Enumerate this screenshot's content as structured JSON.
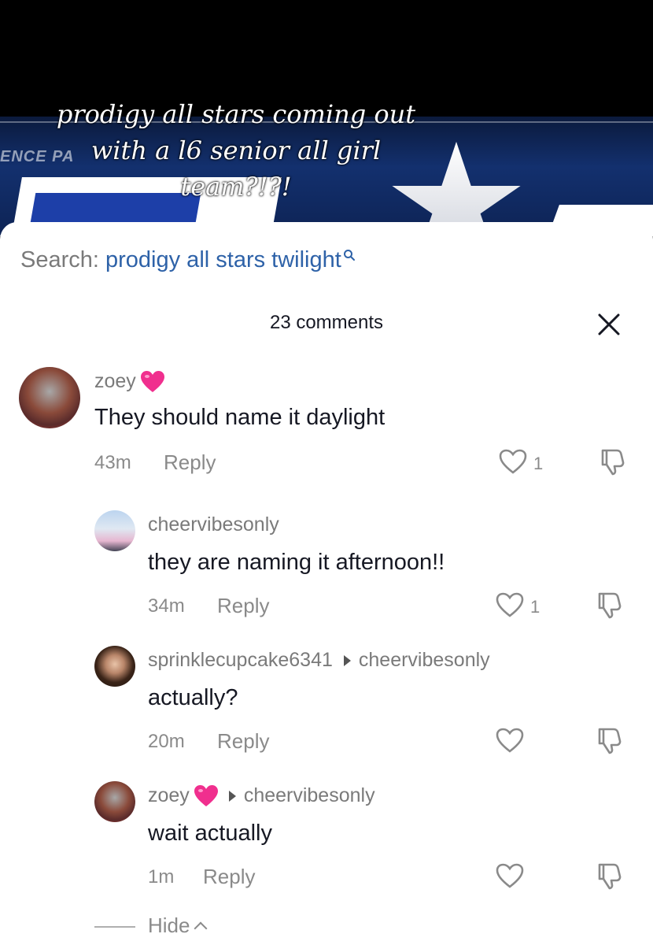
{
  "video": {
    "caption_lines": [
      "prodigy all stars coming out",
      "with a l6 senior all girl",
      "team?!?!"
    ],
    "banner_text": "ENCE PA"
  },
  "search": {
    "label": "Search:",
    "query": "prodigy all stars twilight"
  },
  "comments_header": {
    "count_label": "23 comments"
  },
  "comments": [
    {
      "username": "zoey",
      "text": "They should name it daylight",
      "time": "43m",
      "reply_label": "Reply",
      "likes": "1"
    },
    {
      "username": "cheervibesonly",
      "text": "they are naming it afternoon!!",
      "time": "34m",
      "reply_label": "Reply",
      "likes": "1"
    },
    {
      "username": "sprinklecupcake6341",
      "reply_to": "cheervibesonly",
      "text": "actually?",
      "time": "20m",
      "reply_label": "Reply"
    },
    {
      "username": "zoey",
      "reply_to": "cheervibesonly",
      "text": "wait actually",
      "time": "1m",
      "reply_label": "Reply"
    }
  ],
  "hide_label": "Hide",
  "colors": {
    "link_blue": "#2e62a8",
    "heart_pink": "#f02f8e",
    "muted_gray": "#8a8a8a"
  },
  "icons": [
    "search-icon",
    "close-icon",
    "like-heart-icon",
    "dislike-icon",
    "pink-heart-emoji-icon",
    "reply-arrow-icon",
    "chevron-up-icon"
  ]
}
